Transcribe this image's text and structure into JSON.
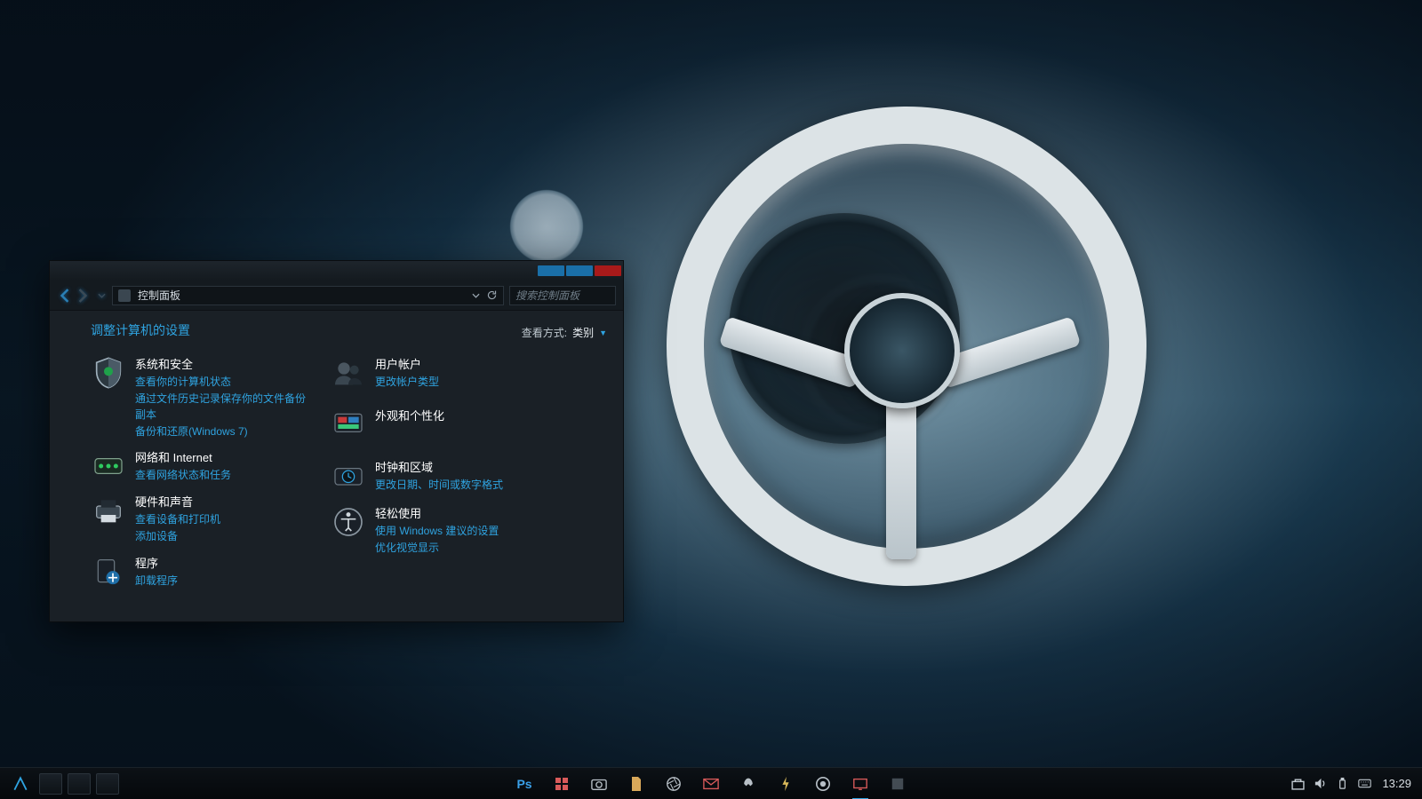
{
  "window": {
    "breadcrumb": "控制面板",
    "search_placeholder": "搜索控制面板",
    "heading": "调整计算机的设置",
    "viewby_label": "查看方式:",
    "viewby_value": "类别"
  },
  "categories": {
    "system": {
      "title": "系统和安全",
      "links": [
        "查看你的计算机状态",
        "通过文件历史记录保存你的文件备份副本",
        "备份和还原(Windows 7)"
      ]
    },
    "network": {
      "title": "网络和 Internet",
      "links": [
        "查看网络状态和任务"
      ]
    },
    "hardware": {
      "title": "硬件和声音",
      "links": [
        "查看设备和打印机",
        "添加设备"
      ]
    },
    "programs": {
      "title": "程序",
      "links": [
        "卸载程序"
      ]
    },
    "users": {
      "title": "用户帐户",
      "links": [
        "更改帐户类型"
      ]
    },
    "appearance": {
      "title": "外观和个性化",
      "links": []
    },
    "clock": {
      "title": "时钟和区域",
      "links": [
        "更改日期、时间或数字格式"
      ]
    },
    "ease": {
      "title": "轻松使用",
      "links": [
        "使用 Windows 建议的设置",
        "优化视觉显示"
      ]
    }
  },
  "taskbar": {
    "clock": "13:29"
  }
}
